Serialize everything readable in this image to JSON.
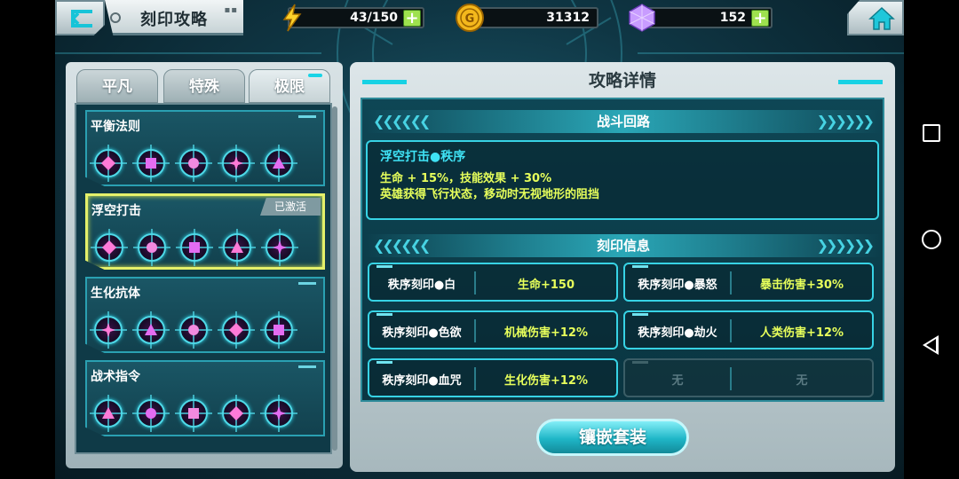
{
  "header": {
    "title": "刻印攻略"
  },
  "resources": {
    "energy": "43/150",
    "gold": "31312",
    "gems": "152"
  },
  "tabs": [
    {
      "label": "平凡",
      "active": false
    },
    {
      "label": "特殊",
      "active": false
    },
    {
      "label": "极限",
      "active": true
    }
  ],
  "sets": [
    {
      "name": "平衡法则",
      "badge": ""
    },
    {
      "name": "浮空打击",
      "badge": "已激活"
    },
    {
      "name": "生化抗体",
      "badge": ""
    },
    {
      "name": "战术指令",
      "badge": ""
    }
  ],
  "detail": {
    "title": "攻略详情",
    "battle_section": "战斗回路",
    "combo_title": "浮空打击●秩序",
    "combo_line1": "生命 + 15%，技能效果 + 30%",
    "combo_line2": "英雄获得飞行状态，移动时无视地形的阻挡",
    "seal_section": "刻印信息",
    "seals": [
      {
        "name": "秩序刻印●白",
        "effect": "生命+150"
      },
      {
        "name": "秩序刻印●暴怒",
        "effect": "暴击伤害+30%"
      },
      {
        "name": "秩序刻印●色欲",
        "effect": "机械伤害+12%"
      },
      {
        "name": "秩序刻印●劫火",
        "effect": "人类伤害+12%"
      },
      {
        "name": "秩序刻印●血咒",
        "effect": "生化伤害+12%"
      },
      {
        "name": "无",
        "effect": "无"
      }
    ],
    "action_label": "镶嵌套装"
  },
  "colors": {
    "accent": "#19d4e6",
    "highlight_text": "#e7ff5b",
    "selected_border": "#e4f06a",
    "plus_button": "#9ee14e"
  }
}
